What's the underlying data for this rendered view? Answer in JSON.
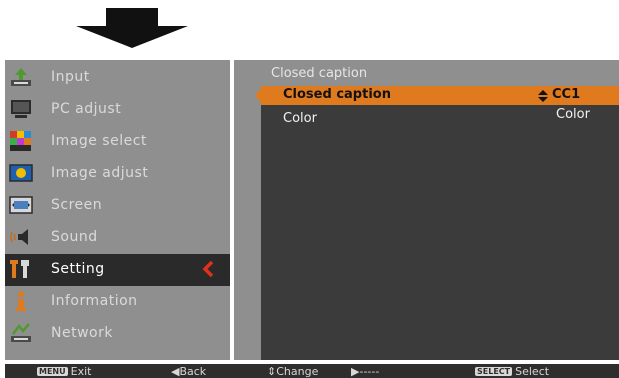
{
  "menu": {
    "items": [
      {
        "label": "Input",
        "icon": "input-icon"
      },
      {
        "label": "PC adjust",
        "icon": "pc-adjust-icon"
      },
      {
        "label": "Image select",
        "icon": "image-select-icon"
      },
      {
        "label": "Image adjust",
        "icon": "image-adjust-icon"
      },
      {
        "label": "Screen",
        "icon": "screen-icon"
      },
      {
        "label": "Sound",
        "icon": "sound-icon"
      },
      {
        "label": "Setting",
        "icon": "setting-icon",
        "active": true
      },
      {
        "label": "Information",
        "icon": "information-icon"
      },
      {
        "label": "Network",
        "icon": "network-icon"
      }
    ]
  },
  "panel": {
    "title": "Closed caption",
    "rows": [
      {
        "label": "Closed caption",
        "value": "CC1",
        "highlighted": true
      },
      {
        "label": "Color",
        "value": "Color"
      }
    ]
  },
  "status": {
    "exit_key": "MENU",
    "exit": "Exit",
    "back": "Back",
    "change": "Change",
    "next": "-----",
    "select_key": "SELECT",
    "select": "Select"
  },
  "colors": {
    "accent": "#e07a1e",
    "panel_gray": "#8f8f8f",
    "panel_dark": "#3b3b3b",
    "status_bar": "#2e2e2e"
  }
}
